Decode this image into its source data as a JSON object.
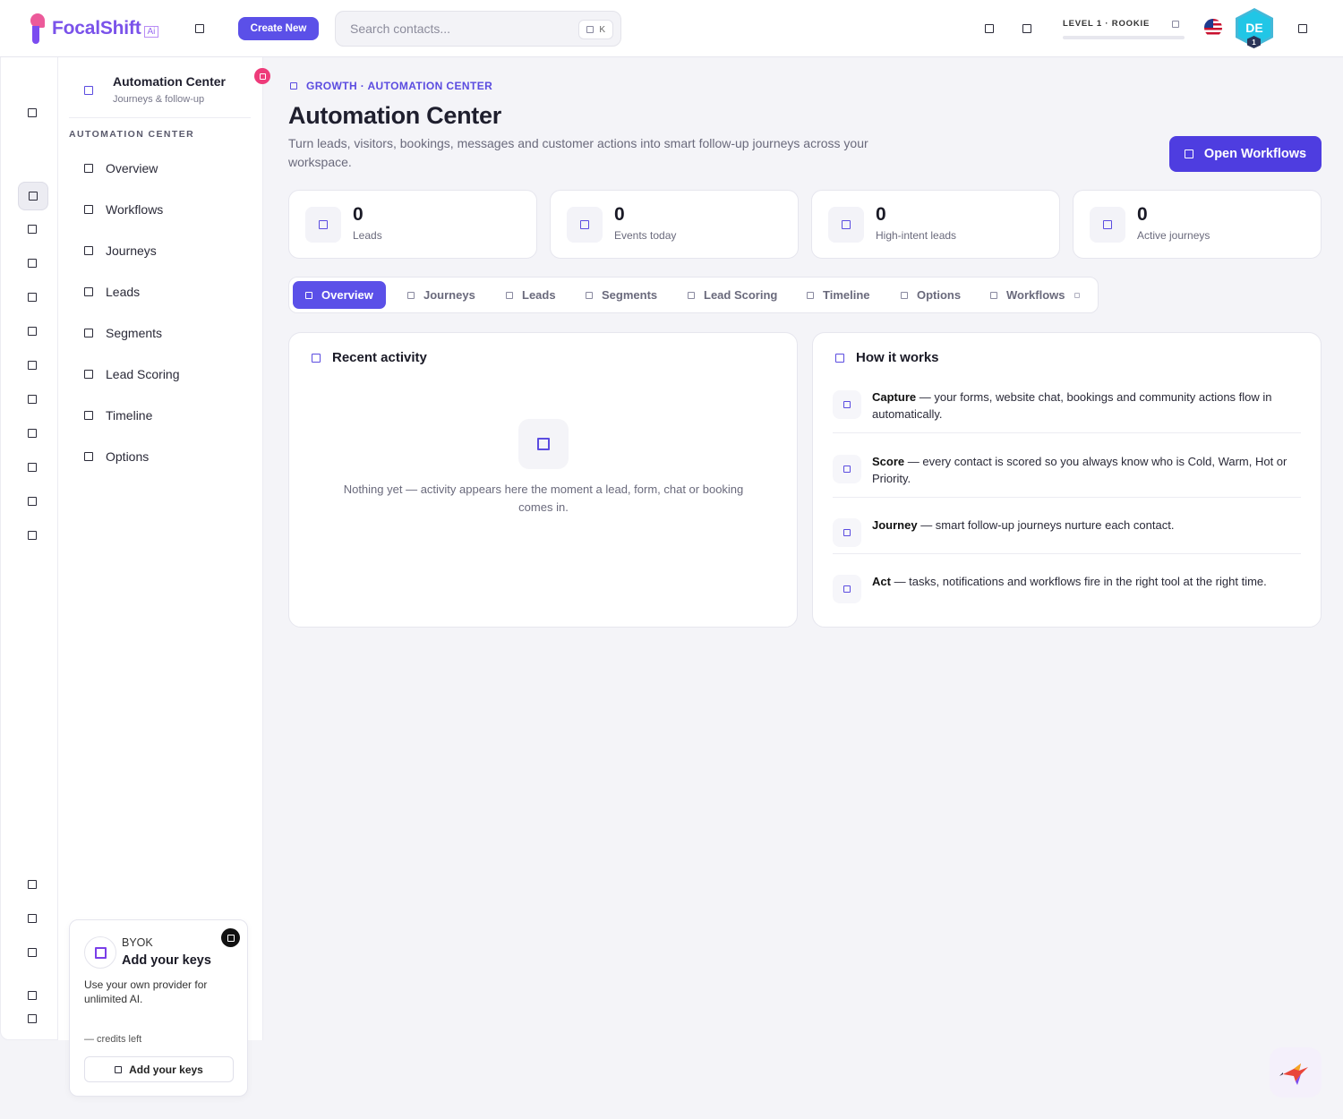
{
  "app": {
    "logo_text": "FocalShift",
    "logo_badge": "Ai",
    "create_label": "Create New",
    "search_placeholder": "Search contacts...",
    "search_shortcut": "K",
    "level_text": "LEVEL 1 · ROOKIE",
    "avatar_initials": "DE",
    "avatar_level": "1",
    "colors": {
      "accent": "#5b50e8",
      "accent_dark": "#4e3de0",
      "badge_pink": "#ee3b7a",
      "avatar": "#21c6e6"
    }
  },
  "sidebar": {
    "title": "Automation Center",
    "subtitle": "Journeys & follow-up",
    "section_label": "AUTOMATION CENTER",
    "items": [
      {
        "label": "Overview"
      },
      {
        "label": "Workflows"
      },
      {
        "label": "Journeys"
      },
      {
        "label": "Leads"
      },
      {
        "label": "Segments"
      },
      {
        "label": "Lead Scoring"
      },
      {
        "label": "Timeline"
      },
      {
        "label": "Options"
      }
    ]
  },
  "byok": {
    "tag": "BYOK",
    "title": "Add your keys",
    "description": "Use your own provider for unlimited AI.",
    "credits": "— credits left",
    "button_label": "Add your keys"
  },
  "main": {
    "breadcrumb": "GROWTH · AUTOMATION CENTER",
    "title": "Automation Center",
    "description": "Turn leads, visitors, bookings, messages and customer actions into smart follow-up journeys across your workspace.",
    "open_workflows_label": "Open Workflows",
    "stats": [
      {
        "value": "0",
        "label": "Leads"
      },
      {
        "value": "0",
        "label": "Events today"
      },
      {
        "value": "0",
        "label": "High-intent leads"
      },
      {
        "value": "0",
        "label": "Active journeys"
      }
    ],
    "tabs": [
      {
        "label": "Overview",
        "active": true
      },
      {
        "label": "Journeys"
      },
      {
        "label": "Leads"
      },
      {
        "label": "Segments"
      },
      {
        "label": "Lead Scoring"
      },
      {
        "label": "Timeline"
      },
      {
        "label": "Options"
      },
      {
        "label": "Workflows"
      }
    ],
    "recent_activity": {
      "title": "Recent activity",
      "empty_text": "Nothing yet — activity appears here the moment a lead, form, chat or booking comes in."
    },
    "how_it_works": {
      "title": "How it works",
      "steps": [
        {
          "term": "Capture",
          "text": " — your forms, website chat, bookings and community actions flow in automatically."
        },
        {
          "term": "Score",
          "text": " — every contact is scored so you always know who is Cold, Warm, Hot or Priority."
        },
        {
          "term": "Journey",
          "text": " — smart follow-up journeys nurture each contact."
        },
        {
          "term": "Act",
          "text": " — tasks, notifications and workflows fire in the right tool at the right time."
        }
      ]
    }
  }
}
